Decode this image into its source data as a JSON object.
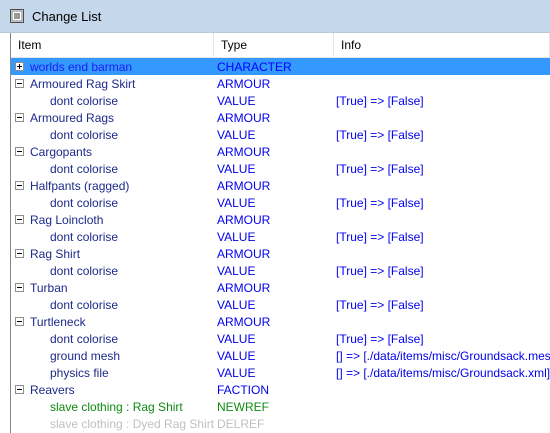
{
  "window": {
    "title": "Change List"
  },
  "columns": {
    "item": "Item",
    "type": "Type",
    "info": "Info"
  },
  "rows": [
    {
      "item": "worlds end barman",
      "type": "CHARACTER",
      "info": "",
      "level": 0,
      "expander": "plus",
      "selected": true,
      "item_color": "blue",
      "type_color": "blue"
    },
    {
      "item": "Armoured Rag Skirt",
      "type": "ARMOUR",
      "info": "",
      "level": 0,
      "expander": "minus",
      "item_color": "navy",
      "type_color": "blue"
    },
    {
      "item": "dont colorise",
      "type": "VALUE",
      "info": "[True] => [False]",
      "level": 1,
      "item_color": "navy",
      "type_color": "blue"
    },
    {
      "item": "Armoured Rags",
      "type": "ARMOUR",
      "info": "",
      "level": 0,
      "expander": "minus",
      "item_color": "navy",
      "type_color": "blue"
    },
    {
      "item": "dont colorise",
      "type": "VALUE",
      "info": "[True] => [False]",
      "level": 1,
      "item_color": "navy",
      "type_color": "blue"
    },
    {
      "item": "Cargopants",
      "type": "ARMOUR",
      "info": "",
      "level": 0,
      "expander": "minus",
      "item_color": "navy",
      "type_color": "blue"
    },
    {
      "item": "dont colorise",
      "type": "VALUE",
      "info": "[True] => [False]",
      "level": 1,
      "item_color": "navy",
      "type_color": "blue"
    },
    {
      "item": "Halfpants (ragged)",
      "type": "ARMOUR",
      "info": "",
      "level": 0,
      "expander": "minus",
      "item_color": "navy",
      "type_color": "blue"
    },
    {
      "item": "dont colorise",
      "type": "VALUE",
      "info": "[True] => [False]",
      "level": 1,
      "item_color": "navy",
      "type_color": "blue"
    },
    {
      "item": "Rag Loincloth",
      "type": "ARMOUR",
      "info": "",
      "level": 0,
      "expander": "minus",
      "item_color": "navy",
      "type_color": "blue"
    },
    {
      "item": "dont colorise",
      "type": "VALUE",
      "info": "[True] => [False]",
      "level": 1,
      "item_color": "navy",
      "type_color": "blue"
    },
    {
      "item": "Rag Shirt",
      "type": "ARMOUR",
      "info": "",
      "level": 0,
      "expander": "minus",
      "item_color": "navy",
      "type_color": "blue"
    },
    {
      "item": "dont colorise",
      "type": "VALUE",
      "info": "[True] => [False]",
      "level": 1,
      "item_color": "navy",
      "type_color": "blue"
    },
    {
      "item": "Turban",
      "type": "ARMOUR",
      "info": "",
      "level": 0,
      "expander": "minus",
      "item_color": "navy",
      "type_color": "blue"
    },
    {
      "item": "dont colorise",
      "type": "VALUE",
      "info": "[True] => [False]",
      "level": 1,
      "item_color": "navy",
      "type_color": "blue"
    },
    {
      "item": "Turtleneck",
      "type": "ARMOUR",
      "info": "",
      "level": 0,
      "expander": "minus",
      "item_color": "navy",
      "type_color": "blue"
    },
    {
      "item": "dont colorise",
      "type": "VALUE",
      "info": "[True] => [False]",
      "level": 1,
      "item_color": "navy",
      "type_color": "blue"
    },
    {
      "item": "ground mesh",
      "type": "VALUE",
      "info": "[] => [./data/items/misc/Groundsack.mesh]",
      "level": 1,
      "item_color": "navy",
      "type_color": "blue"
    },
    {
      "item": "physics file",
      "type": "VALUE",
      "info": "[] => [./data/items/misc/Groundsack.xml]",
      "level": 1,
      "item_color": "navy",
      "type_color": "blue"
    },
    {
      "item": "Reavers",
      "type": "FACTION",
      "info": "",
      "level": 0,
      "expander": "minus",
      "item_color": "navy",
      "type_color": "blue"
    },
    {
      "item": "slave clothing : Rag Shirt",
      "type": "NEWREF",
      "info": "",
      "level": 1,
      "item_color": "green",
      "type_color": "green"
    },
    {
      "item": "slave clothing : Dyed Rag Shirt",
      "type": "DELREF",
      "info": "",
      "level": 1,
      "item_color": "gray",
      "type_color": "gray"
    }
  ],
  "colors": {
    "titlebar": "#c5d7ea",
    "selected_row": "#3399ff",
    "navy": "#1c2a8a",
    "blue": "#0000ee",
    "green": "#0f8a0f",
    "gray": "#c0c0c0"
  }
}
